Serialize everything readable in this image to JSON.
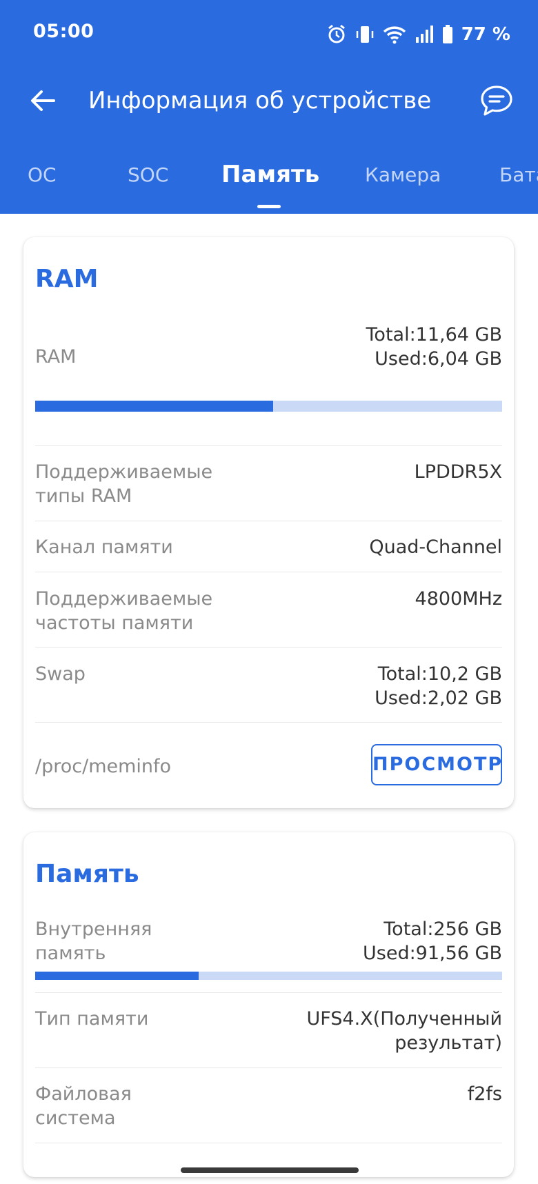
{
  "status_bar": {
    "time": "05:00",
    "battery": "77 %"
  },
  "toolbar": {
    "title": "Информация об устройстве"
  },
  "tabs": [
    {
      "label": "ОС"
    },
    {
      "label": "SOC"
    },
    {
      "label": "Память",
      "active": true
    },
    {
      "label": "Камера"
    },
    {
      "label": "Бата"
    }
  ],
  "ram_card": {
    "title": "RAM",
    "ram": {
      "label": "RAM",
      "total": "Total:11,64 GB",
      "used": "Used:6,04 GB",
      "used_fraction": 0.51
    },
    "rows": [
      {
        "label_line1": "Поддерживаемые",
        "label_line2": "типы RAM",
        "value": "LPDDR5X"
      },
      {
        "label": "Канал памяти",
        "value": "Quad-Channel"
      },
      {
        "label_line1": "Поддерживаемые",
        "label_line2": "частоты памяти",
        "value": "4800MHz"
      }
    ],
    "swap": {
      "label": "Swap",
      "total": "Total:10,2 GB",
      "used": "Used:2,02 GB"
    },
    "meminfo": {
      "label": "/proc/meminfo",
      "button": "ПРОСМОТР"
    }
  },
  "storage_card": {
    "title": "Память",
    "internal": {
      "label_line1": "Внутренняя",
      "label_line2": "память",
      "total": "Total:256 GB",
      "used": "Used:91,56 GB",
      "used_fraction": 0.35
    },
    "type": {
      "label": "Тип памяти",
      "value_line1": "UFS4.X(Полученный",
      "value_line2": "результат)"
    },
    "fs": {
      "label_line1": "Файловая",
      "label_line2": "система",
      "value": "f2fs"
    }
  },
  "colors": {
    "accent": "#2A6BE0",
    "bar_track": "#C9D9F6"
  }
}
